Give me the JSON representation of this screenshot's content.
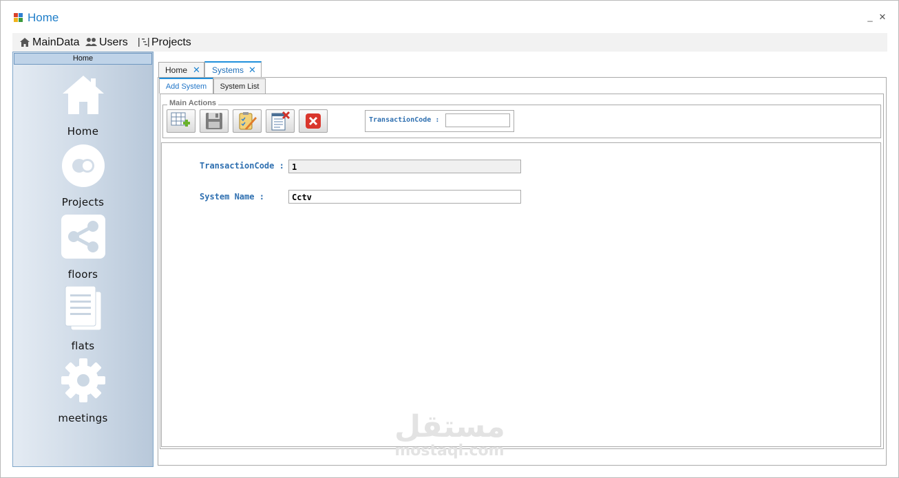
{
  "window": {
    "title": "Home",
    "minimize_glyph": "_",
    "close_glyph": "✕"
  },
  "menu": [
    {
      "label": "MainData",
      "icon": "home-icon"
    },
    {
      "label": "Users",
      "icon": "users-icon"
    },
    {
      "label": "Projects",
      "icon": "sitemap-icon"
    }
  ],
  "sidebar": {
    "header": "Home",
    "items": [
      {
        "label": "Home",
        "icon": "house-icon"
      },
      {
        "label": "Projects",
        "icon": "circle-toggle-icon"
      },
      {
        "label": "floors",
        "icon": "share-icon"
      },
      {
        "label": "flats",
        "icon": "documents-icon"
      },
      {
        "label": "meetings",
        "icon": "gear-icon"
      }
    ]
  },
  "doc_tabs": [
    {
      "label": "Home",
      "active": false
    },
    {
      "label": "Systems",
      "active": true
    }
  ],
  "sub_tabs": [
    {
      "label": "Add System",
      "active": true
    },
    {
      "label": "System List",
      "active": false
    }
  ],
  "main_actions": {
    "legend": "Main Actions",
    "buttons": [
      "add-grid-icon",
      "save-icon",
      "edit-checklist-icon",
      "delete-document-icon",
      "cancel-icon"
    ],
    "transaction_label": "TransactionCode :",
    "transaction_value": ""
  },
  "form": {
    "transaction_label": "TransactionCode :",
    "transaction_value": "1",
    "system_name_label": "System Name :",
    "system_name_value": "Cctv"
  },
  "watermark": {
    "arabic": "مستقل",
    "latin": "mostaql.com"
  },
  "colors": {
    "accent": "#1f8fdb",
    "label_blue": "#2e6fb0",
    "sidebar_border": "#7fa6c9"
  }
}
